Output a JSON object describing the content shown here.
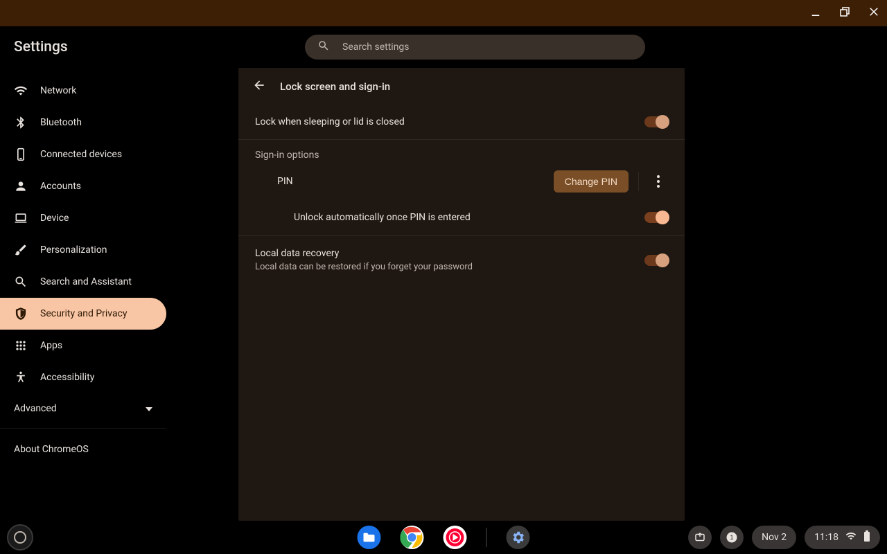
{
  "app_title": "Settings",
  "search": {
    "placeholder": "Search settings"
  },
  "sidebar": {
    "items": [
      {
        "label": "Network"
      },
      {
        "label": "Bluetooth"
      },
      {
        "label": "Connected devices"
      },
      {
        "label": "Accounts"
      },
      {
        "label": "Device"
      },
      {
        "label": "Personalization"
      },
      {
        "label": "Search and Assistant"
      },
      {
        "label": "Security and Privacy"
      },
      {
        "label": "Apps"
      },
      {
        "label": "Accessibility"
      }
    ],
    "advanced": "Advanced",
    "about": "About ChromeOS"
  },
  "panel": {
    "title": "Lock screen and sign-in",
    "lock_sleep": {
      "label": "Lock when sleeping or lid is closed",
      "on": true
    },
    "signin_section": "Sign-in options",
    "pin": {
      "label": "PIN",
      "button": "Change PIN"
    },
    "auto_unlock": {
      "label": "Unlock automatically once PIN is entered",
      "on": true
    },
    "recovery": {
      "label": "Local data recovery",
      "sub": "Local data can be restored if you forget your password",
      "on": true
    }
  },
  "shelf": {
    "date": "Nov 2",
    "time": "11:18",
    "notification_count": "1"
  }
}
